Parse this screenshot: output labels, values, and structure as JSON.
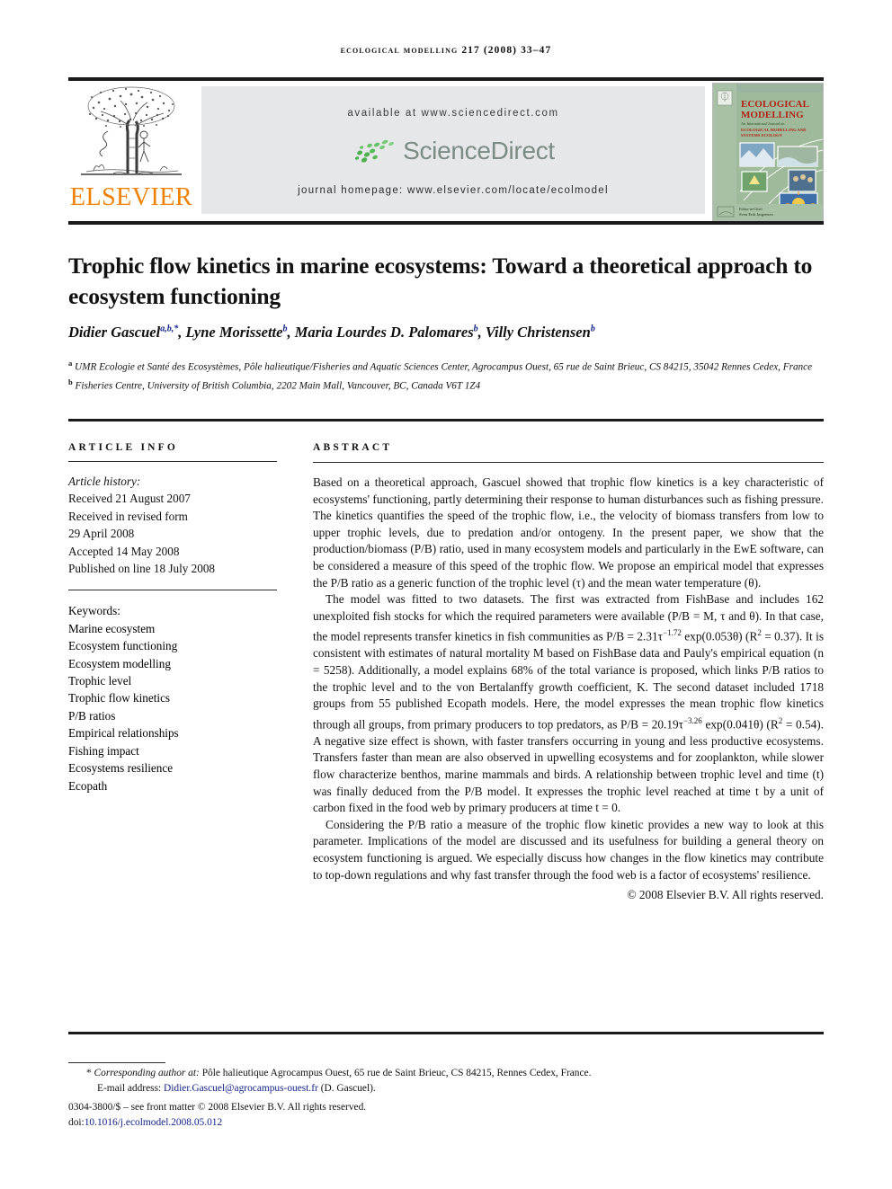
{
  "running_head": {
    "journal": "ECOLOGICAL MODELLING",
    "volume": "217",
    "year": "(2008)",
    "pages": "33–47",
    "full": "ECOLOGICAL MODELLING 217 (2008) 33–47"
  },
  "masthead": {
    "publisher": "ELSEVIER",
    "available_at": "available at www.sciencedirect.com",
    "sciencedirect_word": "ScienceDirect",
    "journal_homepage": "journal homepage: www.elsevier.com/locate/ecolmodel",
    "cover": {
      "title_line1": "ECOLOGICAL",
      "title_line2": "MODELLING",
      "subtitle": "An International Journal on",
      "sub_line2": "ECOLOGICAL MODELLING AND",
      "sub_line3": "SYSTEMS ECOLOGY",
      "editor_label": "Editor-in-Chief",
      "editor_name": "Sven Erik Jørgensen"
    }
  },
  "article": {
    "title": "Trophic flow kinetics in marine ecosystems: Toward a theoretical approach to ecosystem functioning",
    "authors_html": "Didier Gascuel<sup>a,b,*</sup>, Lyne Morissette<sup>b</sup>, Maria Lourdes D. Palomares<sup>b</sup>, Villy Christensen<sup>b</sup>",
    "affiliations": [
      {
        "marker": "a",
        "text": "UMR Ecologie et Santé des Ecosystèmes, Pôle halieutique/Fisheries and Aquatic Sciences Center, Agrocampus Ouest, 65 rue de Saint Brieuc, CS 84215, 35042 Rennes Cedex, France"
      },
      {
        "marker": "b",
        "text": "Fisheries Centre, University of British Columbia, 2202 Main Mall, Vancouver, BC, Canada V6T 1Z4"
      }
    ]
  },
  "article_info": {
    "heading": "ARTICLE INFO",
    "history_label": "Article history:",
    "history": [
      "Received 21 August 2007",
      "Received in revised form",
      "29 April 2008",
      "Accepted 14 May 2008",
      "Published on line 18 July 2008"
    ],
    "keywords_label": "Keywords:",
    "keywords": [
      "Marine ecosystem",
      "Ecosystem functioning",
      "Ecosystem modelling",
      "Trophic level",
      "Trophic flow kinetics",
      "P/B ratios",
      "Empirical relationships",
      "Fishing impact",
      "Ecosystems resilience",
      "Ecopath"
    ]
  },
  "abstract": {
    "heading": "ABSTRACT",
    "paragraphs": [
      "Based on a theoretical approach, Gascuel showed that trophic flow kinetics is a key characteristic of ecosystems' functioning, partly determining their response to human disturbances such as fishing pressure. The kinetics quantifies the speed of the trophic flow, i.e., the velocity of biomass transfers from low to upper trophic levels, due to predation and/or ontogeny. In the present paper, we show that the production/biomass (P/B) ratio, used in many ecosystem models and particularly in the EwE software, can be considered a measure of this speed of the trophic flow. We propose an empirical model that expresses the P/B ratio as a generic function of the trophic level (τ) and the mean water temperature (θ).",
      "The model was fitted to two datasets. The first was extracted from FishBase and includes 162 unexploited fish stocks for which the required parameters were available (P/B = M, τ and θ). In that case, the model represents transfer kinetics in fish communities as P/B = 2.31τ−1.72 exp(0.053θ) (R2 = 0.37). It is consistent with estimates of natural mortality M based on FishBase data and Pauly's empirical equation (n = 5258). Additionally, a model explains 68% of the total variance is proposed, which links P/B ratios to the trophic level and to the von Bertalanffy growth coefficient, K. The second dataset included 1718 groups from 55 published Ecopath models. Here, the model expresses the mean trophic flow kinetics through all groups, from primary producers to top predators, as P/B = 20.19τ−3.26 exp(0.041θ) (R2 = 0.54). A negative size effect is shown, with faster transfers occurring in young and less productive ecosystems. Transfers faster than mean are also observed in upwelling ecosystems and for zooplankton, while slower flow characterize benthos, marine mammals and birds. A relationship between trophic level and time (t) was finally deduced from the P/B model. It expresses the trophic level reached at time t by a unit of carbon fixed in the food web by primary producers at time t = 0.",
      "Considering the P/B ratio a measure of the trophic flow kinetic provides a new way to look at this parameter. Implications of the model are discussed and its usefulness for building a general theory on ecosystem functioning is argued. We especially discuss how changes in the flow kinetics may contribute to top-down regulations and why fast transfer through the food web is a factor of ecosystems' resilience."
    ],
    "copyright": "© 2008 Elsevier B.V. All rights reserved."
  },
  "footnotes": {
    "corresponding_label": "Corresponding author at:",
    "corresponding_text": "Pôle halieutique Agrocampus Ouest, 65 rue de Saint Brieuc, CS 84215, Rennes Cedex, France.",
    "email_label": "E-mail address:",
    "email": "Didier.Gascuel@agrocampus-ouest.fr",
    "email_suffix": "(D. Gascuel).",
    "issn_line": "0304-3800/$ – see front matter © 2008 Elsevier B.V. All rights reserved.",
    "doi_label": "doi:",
    "doi": "10.1016/j.ecolmodel.2008.05.012"
  },
  "colors": {
    "elsevier_orange": "#F08000",
    "sciencedirect_green": "#4CAF50",
    "sciencedirect_gray": "#7c8c85",
    "banner_gray": "#e6e7e8",
    "link_blue": "#14248a",
    "cover_green": "#8fae8b",
    "cover_red": "#b02318"
  }
}
